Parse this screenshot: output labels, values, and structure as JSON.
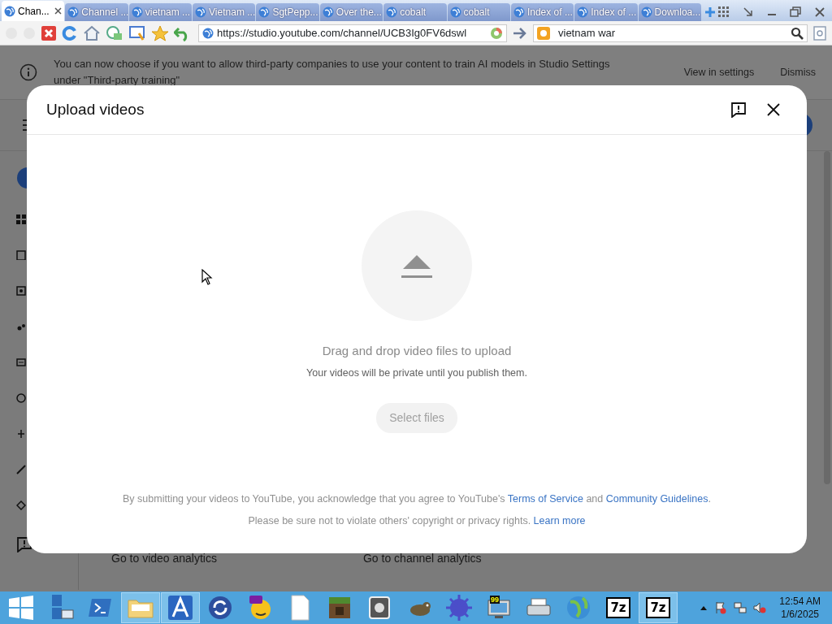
{
  "browser": {
    "tabs": [
      {
        "label": "Chan...",
        "selected": true
      },
      {
        "label": "Channel ...",
        "selected": false
      },
      {
        "label": "vietnam ...",
        "selected": false
      },
      {
        "label": "Vietnam ...",
        "selected": false
      },
      {
        "label": "SgtPepp...",
        "selected": false
      },
      {
        "label": "Over the...",
        "selected": false
      },
      {
        "label": "cobalt",
        "selected": false
      },
      {
        "label": "cobalt",
        "selected": false
      },
      {
        "label": "Index of ...",
        "selected": false
      },
      {
        "label": "Index of ...",
        "selected": false
      },
      {
        "label": "Downloa...",
        "selected": false
      }
    ],
    "address": "https://studio.youtube.com/channel/UCB3Ig0FV6dswl",
    "search": "vietnam war"
  },
  "banner": {
    "text": "You can now choose if you want to allow third-party companies to use your content to train AI models in Studio Settings under \"Third-party training\"",
    "buttons": [
      "View in settings",
      "Dismiss"
    ]
  },
  "page": {
    "cards": [
      {
        "link": "Go to video analytics"
      },
      {
        "link": "Go to channel analytics"
      }
    ]
  },
  "dialog": {
    "title": "Upload videos",
    "prompt": "Drag and drop video files to upload",
    "note": "Your videos will be private until you publish them.",
    "button": {
      "label": "Select files",
      "disabled": true
    },
    "footer": [
      [
        {
          "kind": "text",
          "text": "By submitting your videos to YouTube, you acknowledge that you agree to YouTube's "
        },
        {
          "kind": "link",
          "text": "Terms of Service"
        },
        {
          "kind": "text",
          "text": " and "
        },
        {
          "kind": "link",
          "text": "Community Guidelines"
        },
        {
          "kind": "text",
          "text": "."
        }
      ],
      [
        {
          "kind": "text",
          "text": "Please be sure not to violate others' copyright or privacy rights. "
        },
        {
          "kind": "link",
          "text": "Learn more"
        }
      ]
    ]
  },
  "taskbar": {
    "items": [
      {
        "active": false
      },
      {
        "active": false
      },
      {
        "active": false
      },
      {
        "active": true
      },
      {
        "active": true
      },
      {
        "active": false
      },
      {
        "active": false
      },
      {
        "active": false
      },
      {
        "active": false
      },
      {
        "active": false
      },
      {
        "active": false
      },
      {
        "active": false
      },
      {
        "active": false,
        "label": "99"
      },
      {
        "active": false
      },
      {
        "active": false
      },
      {
        "active": false,
        "label": "7z"
      },
      {
        "active": true,
        "label": "7z"
      }
    ],
    "time": "12:54 AM",
    "date": "1/6/2025"
  }
}
